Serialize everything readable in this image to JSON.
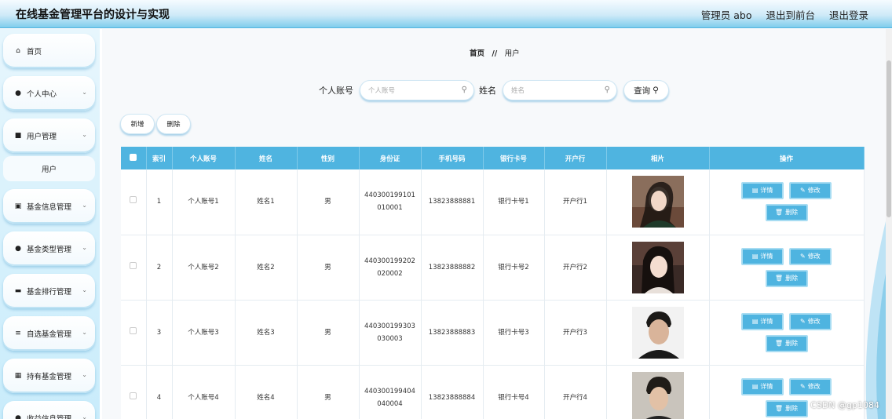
{
  "header": {
    "title": "在线基金管理平台的设计与实现",
    "nav": [
      "管理员 abo",
      "退出到前台",
      "退出登录"
    ]
  },
  "sidebar": {
    "items": [
      {
        "label": "首页",
        "icon": "home-icon"
      },
      {
        "label": "个人中心",
        "icon": "user-icon"
      },
      {
        "label": "用户管理",
        "icon": "monitor-icon"
      },
      {
        "label": "基金信息管理",
        "icon": "clipboard-icon"
      },
      {
        "label": "基金类型管理",
        "icon": "user-icon"
      },
      {
        "label": "基金排行管理",
        "icon": "ticket-icon"
      },
      {
        "label": "自选基金管理",
        "icon": "sliders-icon"
      },
      {
        "label": "持有基金管理",
        "icon": "grid-icon"
      },
      {
        "label": "收益信息管理",
        "icon": "user-icon"
      }
    ],
    "submenu": {
      "label": "用户"
    }
  },
  "breadcrumb": {
    "home": "首页",
    "sep": "//",
    "current": "用户"
  },
  "search": {
    "account_label": "个人账号",
    "account_placeholder": "个人账号",
    "name_label": "姓名",
    "name_placeholder": "姓名",
    "query_button": "查询"
  },
  "actions": {
    "add": "新增",
    "delete": "删除"
  },
  "table": {
    "headers": [
      "索引",
      "个人账号",
      "姓名",
      "性别",
      "身份证",
      "手机号码",
      "银行卡号",
      "开户行",
      "相片",
      "操作"
    ],
    "rows": [
      {
        "index": "1",
        "account": "个人账号1",
        "name": "姓名1",
        "gender": "男",
        "id_card": "440300199101010001",
        "phone": "13823888881",
        "bank_card": "银行卡号1",
        "bank": "开户行1"
      },
      {
        "index": "2",
        "account": "个人账号2",
        "name": "姓名2",
        "gender": "男",
        "id_card": "440300199202020002",
        "phone": "13823888882",
        "bank_card": "银行卡号2",
        "bank": "开户行2"
      },
      {
        "index": "3",
        "account": "个人账号3",
        "name": "姓名3",
        "gender": "男",
        "id_card": "440300199303030003",
        "phone": "13823888883",
        "bank_card": "银行卡号3",
        "bank": "开户行3"
      },
      {
        "index": "4",
        "account": "个人账号4",
        "name": "姓名4",
        "gender": "男",
        "id_card": "440300199404040004",
        "phone": "13823888884",
        "bank_card": "银行卡号4",
        "bank": "开户行4"
      }
    ],
    "op_detail": "详情",
    "op_edit": "修改",
    "op_delete": "删除"
  },
  "watermark": "CSDN @gp1084",
  "colors": {
    "accent": "#4fb4e0",
    "header_gradient_end": "#7fcdec"
  }
}
